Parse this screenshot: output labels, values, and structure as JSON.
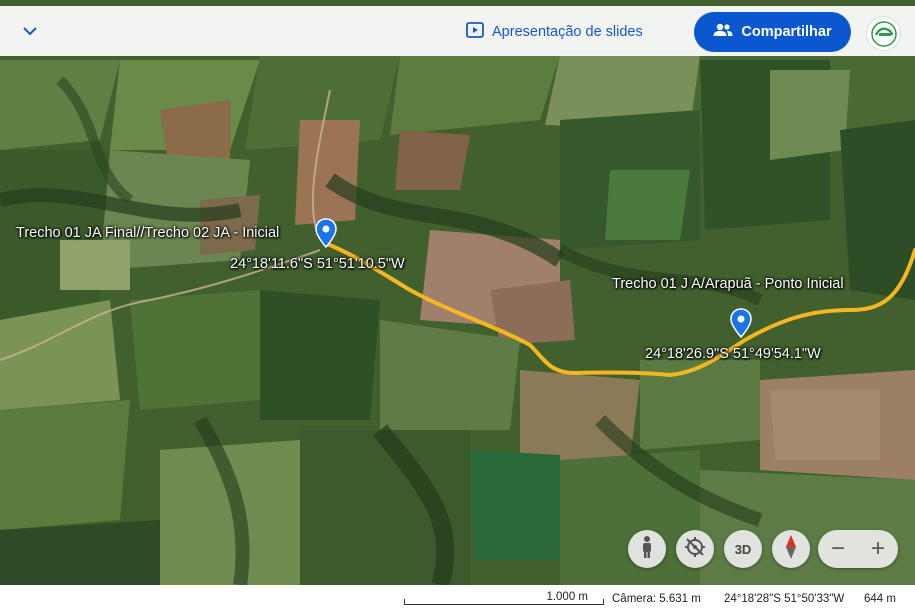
{
  "topbar": {
    "slideshow_label": "Apresentação de slides",
    "share_label": "Compartilhar"
  },
  "markers": [
    {
      "title": "Trecho 01 JA Final//Trecho 02 JA - Inicial",
      "coords": "24°18'11.6\"S 51°51'10.5\"W"
    },
    {
      "title": "Trecho 01 J A/Arapuã - Ponto Inicial",
      "coords": "24°18'26.9\"S 51°49'54.1\"W"
    }
  ],
  "controls": {
    "btn_3d": "3D",
    "zoom_out": "−",
    "zoom_in": "+"
  },
  "statusbar": {
    "scale": "1.000 m",
    "camera": "Câmera: 5.631 m",
    "coordinates": "24°18'28\"S 51°50'33\"W",
    "altitude": "644 m"
  },
  "colors": {
    "route": "#f6b622",
    "marker": "#1a73e8",
    "accent": "#0b57d0"
  }
}
